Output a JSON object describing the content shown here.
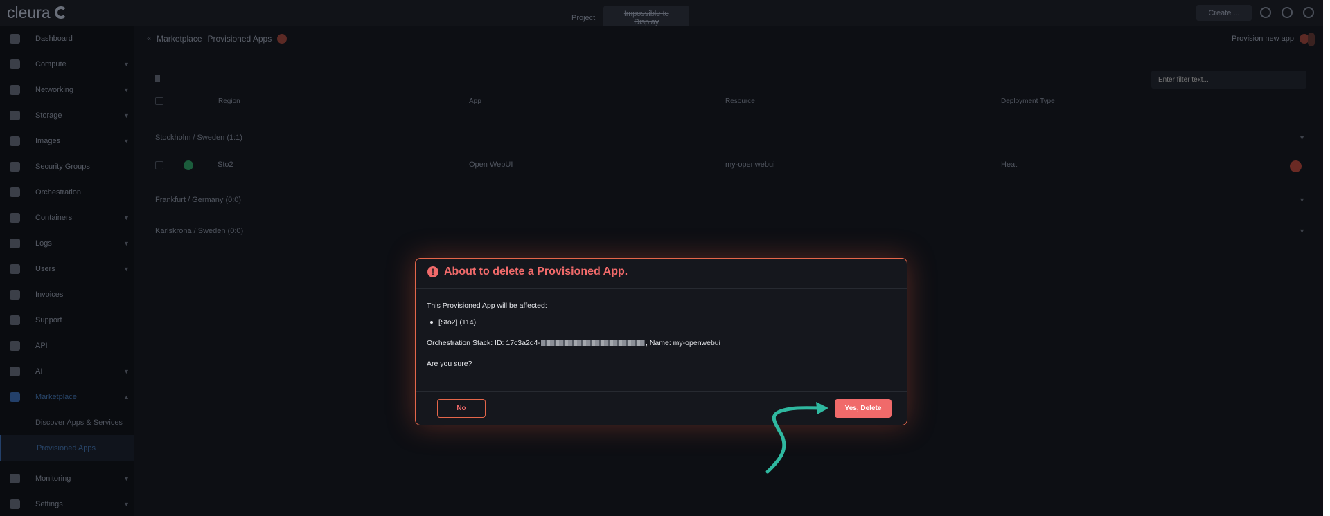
{
  "topbar": {
    "logo_text": "cleura",
    "project_label": "Project",
    "project_value": "Impossible to Display",
    "create_label": "Create ..."
  },
  "sidebar": {
    "items": [
      {
        "label": "Dashboard",
        "icon": "bar-chart-icon"
      },
      {
        "label": "Compute",
        "icon": "server-icon"
      },
      {
        "label": "Networking",
        "icon": "network-icon"
      },
      {
        "label": "Storage",
        "icon": "database-icon"
      },
      {
        "label": "Images",
        "icon": "camera-icon"
      },
      {
        "label": "Security Groups",
        "icon": "shield-icon"
      },
      {
        "label": "Orchestration",
        "icon": "orchestration-icon"
      },
      {
        "label": "Containers",
        "icon": "containers-icon"
      },
      {
        "label": "Logs",
        "icon": "history-icon"
      },
      {
        "label": "Users",
        "icon": "user-icon"
      },
      {
        "label": "Invoices",
        "icon": "calculator-icon"
      },
      {
        "label": "Support",
        "icon": "lifebuoy-icon"
      },
      {
        "label": "API",
        "icon": "plug-icon"
      },
      {
        "label": "AI",
        "icon": "ai-icon"
      },
      {
        "label": "Marketplace",
        "icon": "cart-icon"
      }
    ],
    "sub_items": [
      {
        "label": "Discover Apps & Services"
      },
      {
        "label": "Provisioned Apps"
      }
    ],
    "bottom_items": [
      {
        "label": "Monitoring",
        "icon": "line-chart-icon"
      },
      {
        "label": "Settings",
        "icon": "gear-icon"
      }
    ]
  },
  "main": {
    "breadcrumb": [
      "Marketplace",
      "Provisioned Apps"
    ],
    "provision_label": "Provision new app",
    "filter_placeholder": "Enter filter text...",
    "columns": [
      "Region",
      "App",
      "Resource",
      "Deployment Type"
    ],
    "groups": [
      {
        "label": "Stockholm / Sweden (1:1)"
      },
      {
        "label": "Frankfurt / Germany (0:0)"
      },
      {
        "label": "Karlskrona / Sweden (0:0)"
      }
    ],
    "row": {
      "region": "Sto2",
      "app": "Open WebUI",
      "resource": "my-openwebui",
      "deployment_type": "Heat"
    }
  },
  "modal": {
    "title": "About to delete a Provisioned App.",
    "intro": "This Provisioned App will be affected:",
    "item": "[Sto2] (114)",
    "stack_prefix": "Orchestration Stack: ID: 17c3a2d4-",
    "stack_suffix": ", Name: my-openwebui",
    "question": "Are you sure?",
    "no_label": "No",
    "yes_label": "Yes, Delete"
  },
  "colors": {
    "accent": "#f06a6a",
    "border": "#e4664a",
    "annotation": "#2fb8a0"
  }
}
